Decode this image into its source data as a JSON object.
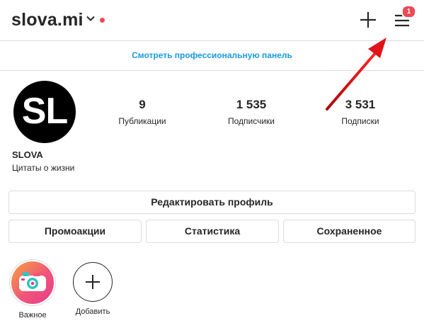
{
  "header": {
    "username": "slova.mi",
    "notification_count": "1"
  },
  "pro_dashboard": {
    "label": "Смотреть профессиональную панель"
  },
  "profile": {
    "avatar_text": "SL",
    "name": "SLOVA",
    "bio": "Цитаты о жизни"
  },
  "stats": [
    {
      "value": "9",
      "label": "Публикации"
    },
    {
      "value": "1 535",
      "label": "Подписчики"
    },
    {
      "value": "3 531",
      "label": "Подписки"
    }
  ],
  "buttons": {
    "edit_profile": "Редактировать профиль",
    "promotions": "Промоакции",
    "insights": "Статистика",
    "saved": "Сохраненное"
  },
  "highlights": [
    {
      "label": "Важное",
      "icon": "camera-icon"
    },
    {
      "label": "Добавить",
      "icon": "plus-icon"
    }
  ],
  "colors": {
    "link_blue": "#1a9ae0",
    "badge_red": "#ed4956",
    "arrow_red": "#e0141b"
  }
}
